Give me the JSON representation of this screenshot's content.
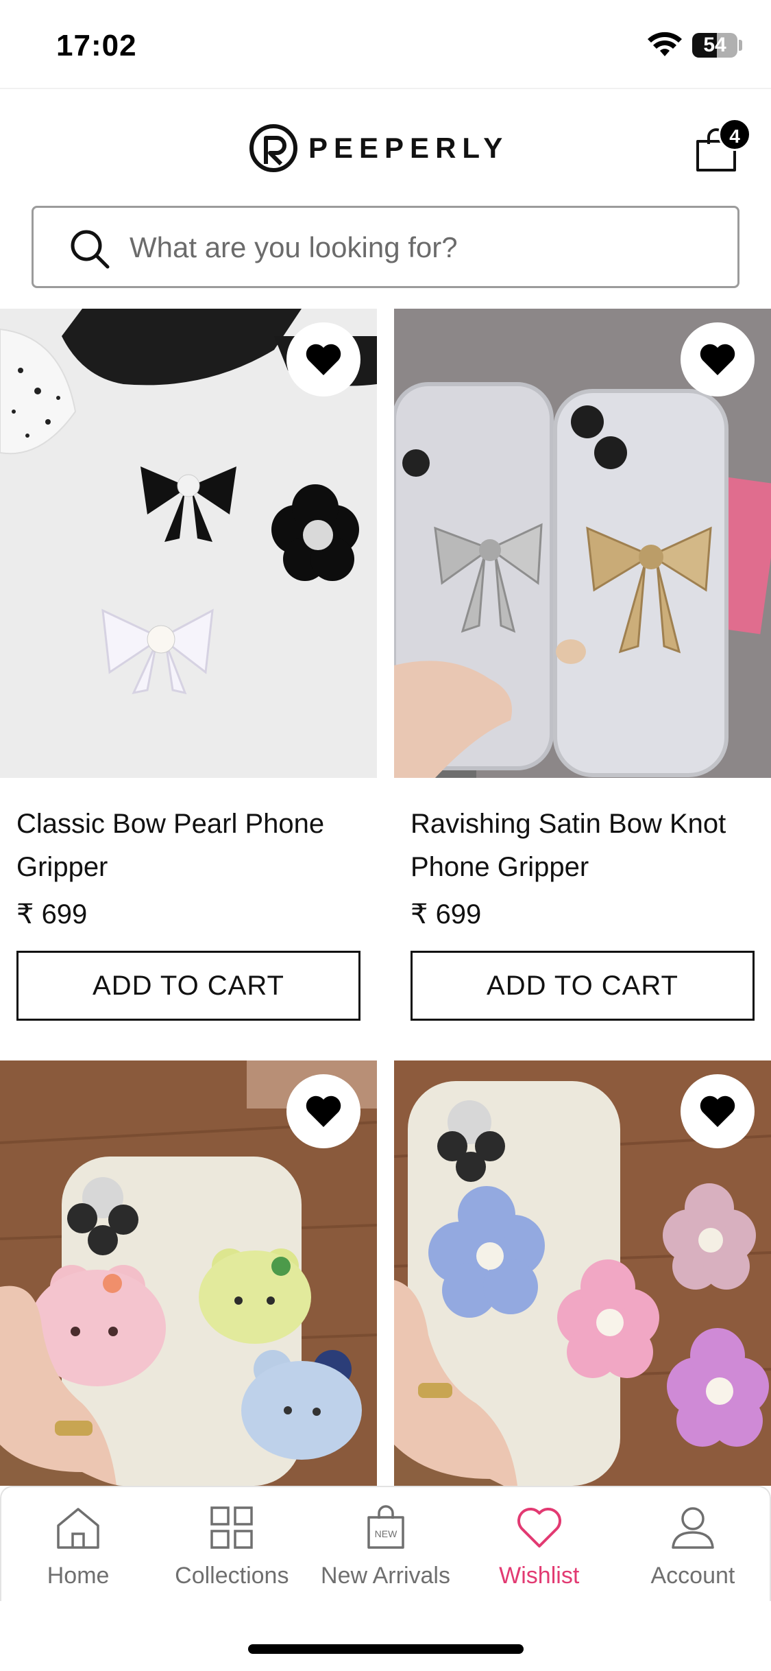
{
  "status_bar": {
    "time": "17:02",
    "battery": "54",
    "battery_level": 0.54
  },
  "header": {
    "brand": "PEEPERLY",
    "cart_count": "4"
  },
  "search": {
    "placeholder": "What are you looking for?"
  },
  "products": [
    {
      "title": "Classic Bow Pearl Phone Gripper",
      "price": "₹ 699",
      "cta": "ADD TO CART",
      "wishlisted": true
    },
    {
      "title": "Ravishing Satin Bow Knot Phone Gripper",
      "price": "₹ 699",
      "cta": "ADD TO CART",
      "wishlisted": true
    },
    {
      "title": "",
      "price": "",
      "cta": "",
      "wishlisted": true
    },
    {
      "title": "",
      "price": "",
      "cta": "",
      "wishlisted": true
    }
  ],
  "tab_bar": {
    "tabs": [
      {
        "label": "Home",
        "icon": "home-icon"
      },
      {
        "label": "Collections",
        "icon": "grid-icon"
      },
      {
        "label": "New Arrivals",
        "icon": "new-bag-icon",
        "icon_text": "NEW"
      },
      {
        "label": "Wishlist",
        "icon": "heart-icon",
        "active": true
      },
      {
        "label": "Account",
        "icon": "person-icon"
      }
    ]
  },
  "colors": {
    "accent": "#e23a72",
    "text": "#111111",
    "muted": "#6f6f6f"
  }
}
